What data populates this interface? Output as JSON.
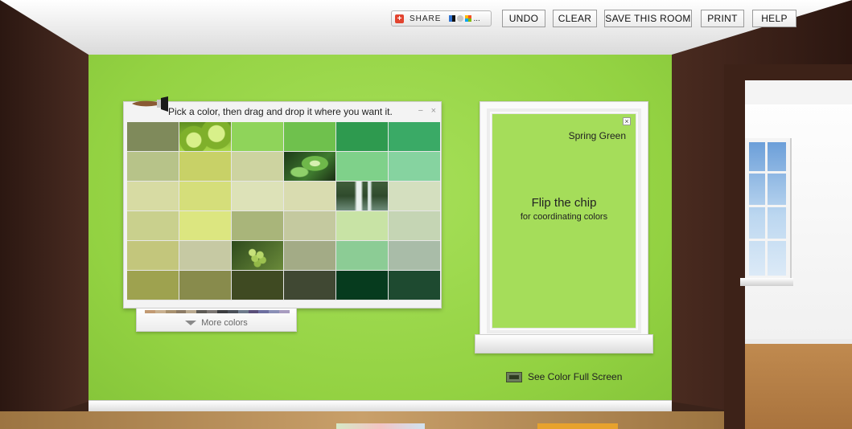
{
  "toolbar": {
    "share_label": "SHARE",
    "share_more": "...",
    "undo_label": "UNDO",
    "clear_label": "CLEAR",
    "save_label": "SAVE THIS ROOM",
    "print_label": "PRINT",
    "help_label": "HELP"
  },
  "palette": {
    "instruction": "Pick a color, then drag and drop it where you want it.",
    "minimize_glyph": "−",
    "close_glyph": "×",
    "more_colors_label": "More colors",
    "swatches": [
      [
        "#7f8a5b",
        "photo-apples",
        "#8fd45a",
        "#6fc14d",
        "#2e9a4f",
        "#3aaa66"
      ],
      [
        "#b7c389",
        "#c8d167",
        "#cdd3a0",
        "photo-leaves",
        "#7fd18a",
        "#86d3a0"
      ],
      [
        "#d7dba3",
        "#d5de7a",
        "#dde2b8",
        "#d9dcb0",
        "photo-waterfall",
        "#d4dfbf"
      ],
      [
        "#c9d08d",
        "#dce680",
        "#a9b57a",
        "#c4c99f",
        "#c8e3a5",
        "#c5d5b4"
      ],
      [
        "#c3c67c",
        "#c6c9a3",
        "photo-grapes",
        "#a3ab86",
        "#8ccc95",
        "#a9bca8"
      ],
      [
        "#9ea24f",
        "#888b4c",
        "#3f4a22",
        "#404833",
        "#063b1e",
        "#1e4a30"
      ]
    ],
    "mini_strip": [
      "#c29a73",
      "#c9b08f",
      "#a8916f",
      "#8c7b65",
      "#b9a98f",
      "#5d5a55",
      "#7c7773",
      "#3c3d40",
      "#4a4f58",
      "#6e7b8c",
      "#5a4f7a",
      "#6d6fa0",
      "#8a8fb6",
      "#a89cc0"
    ]
  },
  "chip": {
    "color_name": "Spring Green",
    "close_glyph": "×",
    "flip_title": "Flip the chip",
    "flip_subtitle": "for coordinating colors",
    "color_hex": "#a5dd5a"
  },
  "fullscreen": {
    "label": "See Color Full Screen"
  },
  "icons": {
    "share": "share-plus-icon",
    "brush": "paint-brush-icon",
    "fullscreen": "monitor-icon",
    "more": "triangle-down-icon"
  }
}
